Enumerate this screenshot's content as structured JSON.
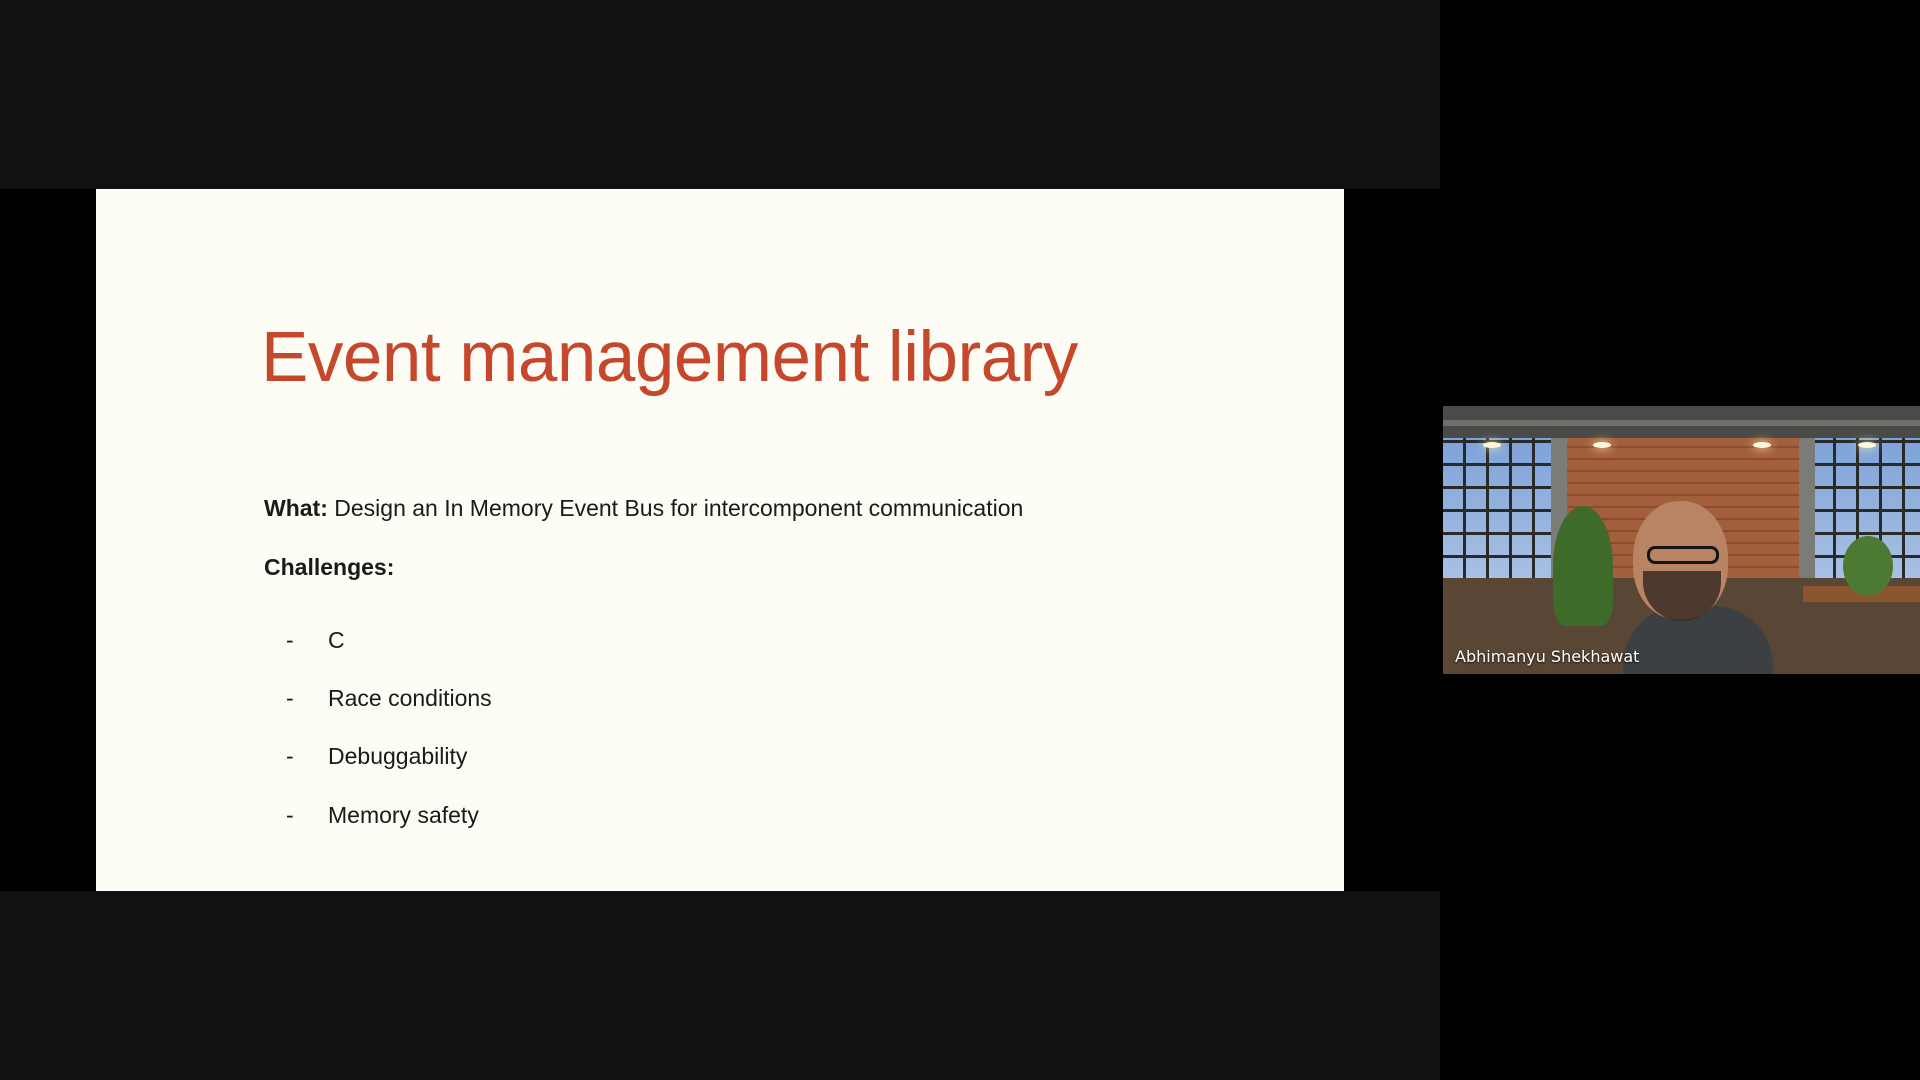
{
  "slide": {
    "title": "Event management library",
    "what_label": "What:",
    "what_text": " Design an In Memory Event Bus for intercomponent communication",
    "challenges_label": "Challenges:",
    "bullet_marker": "-",
    "bullets": [
      "C",
      "Race conditions",
      "Debuggability",
      "Memory safety"
    ]
  },
  "participant": {
    "name": "Abhimanyu Shekhawat"
  },
  "colors": {
    "title": "#c5472c",
    "slide_background": "#fdfcf5",
    "stage_background": "#111111"
  }
}
